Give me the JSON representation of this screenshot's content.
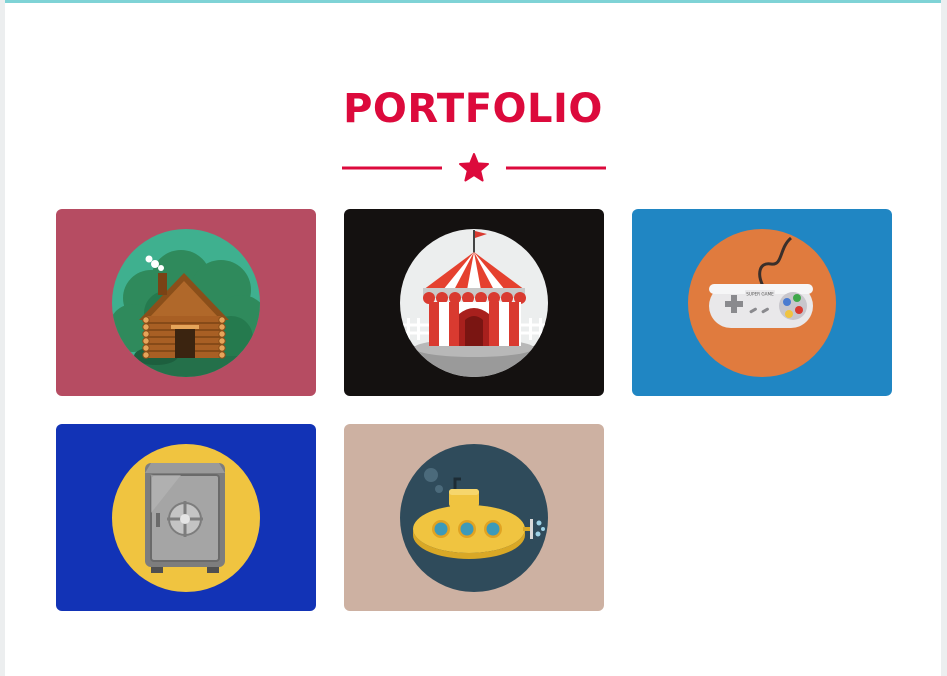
{
  "section": {
    "title": "PORTFOLIO",
    "divider_icon": "star-icon",
    "accent_color": "#dc0a3c",
    "top_bar_color": "#7fd3d6"
  },
  "portfolio": {
    "items": [
      {
        "id": "cabin",
        "icon": "log-cabin-icon",
        "background": "#b64c62",
        "circle": "#3fb08f"
      },
      {
        "id": "circus",
        "icon": "circus-tent-icon",
        "background": "#141110",
        "circle": "#eceeee"
      },
      {
        "id": "gamepad",
        "icon": "gamepad-icon",
        "background": "#2086c3",
        "circle": "#e07b3e"
      },
      {
        "id": "safe",
        "icon": "safe-icon",
        "background": "#1233b6",
        "circle": "#f0c440"
      },
      {
        "id": "submarine",
        "icon": "submarine-icon",
        "background": "#cdb1a2",
        "circle": "#2f4b5b"
      }
    ],
    "gamepad_brand": "SUPER GAME"
  }
}
